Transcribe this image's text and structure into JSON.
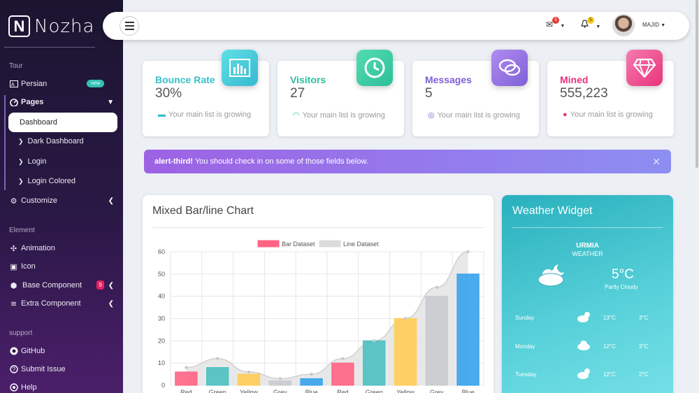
{
  "brand": {
    "logo_letter": "N",
    "name": "Nozha"
  },
  "sidebar": {
    "sections": {
      "tour": "Tour",
      "element": "Element",
      "support": "support"
    },
    "persian": {
      "label": "Persian",
      "badge": "new"
    },
    "pages": {
      "label": "Pages"
    },
    "active": {
      "label": "Dashboard"
    },
    "subitems": [
      "Dark Dashboard",
      "Login",
      "Login Colored"
    ],
    "customize": {
      "label": "Customize"
    },
    "animation": {
      "label": "Animation"
    },
    "icon": {
      "label": "Icon"
    },
    "base": {
      "label": "Base Component",
      "badge": "9"
    },
    "extra": {
      "label": "Extra Component"
    },
    "github": {
      "label": "GitHub"
    },
    "submit": {
      "label": "Submit Issue"
    },
    "help": {
      "label": "Help"
    }
  },
  "topbar": {
    "mail_count": "5",
    "bell_count": "5",
    "user": "MAJID"
  },
  "cards": [
    {
      "title": "Bounce Rate",
      "value": "30%",
      "footer": "Your main list is growing",
      "color": "#36c2c9",
      "icon": "bar-chart-icon"
    },
    {
      "title": "Visitors",
      "value": "27",
      "footer": "Your main list is growing",
      "color": "#2bbf9b",
      "icon": "clock-icon"
    },
    {
      "title": "Messages",
      "value": "5",
      "footer": "Your main list is growing",
      "color": "#7f5fd6",
      "icon": "chat-icon"
    },
    {
      "title": "Mined",
      "value": "555,223",
      "footer": "Your main list is growing",
      "color": "#e8347b",
      "icon": "diamond-icon"
    }
  ],
  "alert": {
    "strong": "alert-third!",
    "text": "You should check in on some of those fields below."
  },
  "chart_card": {
    "title": "Mixed Bar/line Chart"
  },
  "chart_data": {
    "type": "bar",
    "categories": [
      "Red",
      "Green",
      "Yellow",
      "Grey",
      "Blue",
      "Red",
      "Green",
      "Yellow",
      "Grey",
      "Blue"
    ],
    "series": [
      {
        "name": "Bar Dataset",
        "type": "bar",
        "values": [
          6,
          8,
          5,
          2,
          3,
          10,
          20,
          30,
          40,
          50
        ],
        "colors": [
          "#ff6384",
          "#4bc0c0",
          "#ffcd56",
          "#c9cbcf",
          "#36a2eb",
          "#ff6384",
          "#4bc0c0",
          "#ffcd56",
          "#c9cbcf",
          "#36a2eb"
        ]
      },
      {
        "name": "Line Dataset",
        "type": "line",
        "values": [
          8,
          12,
          6,
          3,
          5,
          12,
          20,
          30,
          44,
          60
        ],
        "color": "#dcdcdc"
      }
    ],
    "ylim": [
      0,
      60
    ],
    "yticks": [
      0,
      10,
      20,
      30,
      40,
      50,
      60
    ],
    "legend": "top",
    "grid": true
  },
  "weather": {
    "title": "Weather Widget",
    "city": "URMIA",
    "sub": "WEATHER",
    "temp": "5°C",
    "cond": "Partly Cloudy",
    "days": [
      {
        "day": "Sunday",
        "icon": "sun-cloud-icon",
        "hi": "13°C",
        "lo": "3°C"
      },
      {
        "day": "Monday",
        "icon": "cloud-icon",
        "hi": "12°C",
        "lo": "3°C"
      },
      {
        "day": "Tuesday",
        "icon": "sun-cloud-icon",
        "hi": "12°C",
        "lo": "2°C"
      }
    ]
  }
}
